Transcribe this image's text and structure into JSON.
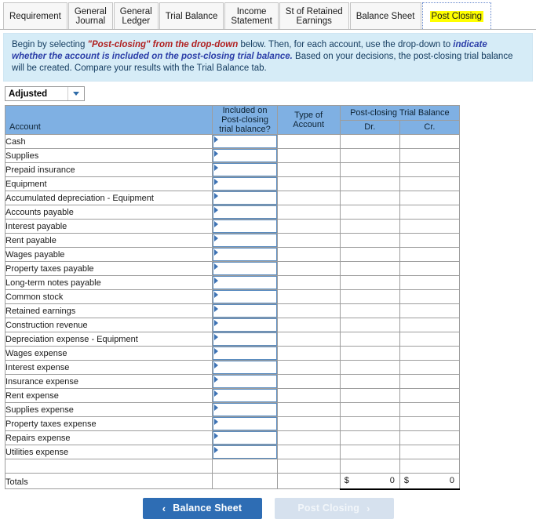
{
  "tabs": [
    {
      "label": "Requirement",
      "active": false
    },
    {
      "label": "General\nJournal",
      "active": false
    },
    {
      "label": "General\nLedger",
      "active": false
    },
    {
      "label": "Trial Balance",
      "active": false
    },
    {
      "label": "Income\nStatement",
      "active": false
    },
    {
      "label": "St of Retained\nEarnings",
      "active": false
    },
    {
      "label": "Balance Sheet",
      "active": false
    },
    {
      "label": "Post Closing",
      "active": true
    }
  ],
  "instructions": {
    "part1": "Begin by selecting ",
    "emph_red": "\"Post-closing\" from the drop-down",
    "part2": " below.  Then, for each account, use the drop-down to ",
    "emph_blue": "indicate whether the account is included on the post-closing trial balance.",
    "part3": "  Based on your decisions, the post-closing trial balance will be created.  Compare your results with the Trial Balance tab."
  },
  "period_select": {
    "value": "Adjusted",
    "icon": "chevron-down-icon"
  },
  "table": {
    "headers": {
      "account": "Account",
      "included": "Included on\nPost-closing\ntrial balance?",
      "type_of_account": "Type of\nAccount",
      "group": "Post-closing Trial Balance",
      "dr": "Dr.",
      "cr": "Cr."
    },
    "rows": [
      {
        "account": "Cash",
        "included": "",
        "type": "",
        "dr": "",
        "cr": ""
      },
      {
        "account": "Supplies",
        "included": "",
        "type": "",
        "dr": "",
        "cr": ""
      },
      {
        "account": "Prepaid insurance",
        "included": "",
        "type": "",
        "dr": "",
        "cr": ""
      },
      {
        "account": "Equipment",
        "included": "",
        "type": "",
        "dr": "",
        "cr": ""
      },
      {
        "account": "Accumulated depreciation - Equipment",
        "included": "",
        "type": "",
        "dr": "",
        "cr": ""
      },
      {
        "account": "Accounts payable",
        "included": "",
        "type": "",
        "dr": "",
        "cr": ""
      },
      {
        "account": "Interest payable",
        "included": "",
        "type": "",
        "dr": "",
        "cr": ""
      },
      {
        "account": "Rent payable",
        "included": "",
        "type": "",
        "dr": "",
        "cr": ""
      },
      {
        "account": "Wages payable",
        "included": "",
        "type": "",
        "dr": "",
        "cr": ""
      },
      {
        "account": "Property taxes payable",
        "included": "",
        "type": "",
        "dr": "",
        "cr": ""
      },
      {
        "account": "Long-term notes payable",
        "included": "",
        "type": "",
        "dr": "",
        "cr": ""
      },
      {
        "account": "Common stock",
        "included": "",
        "type": "",
        "dr": "",
        "cr": ""
      },
      {
        "account": "Retained earnings",
        "included": "",
        "type": "",
        "dr": "",
        "cr": ""
      },
      {
        "account": "Construction revenue",
        "included": "",
        "type": "",
        "dr": "",
        "cr": ""
      },
      {
        "account": "Depreciation expense - Equipment",
        "included": "",
        "type": "",
        "dr": "",
        "cr": ""
      },
      {
        "account": "Wages expense",
        "included": "",
        "type": "",
        "dr": "",
        "cr": ""
      },
      {
        "account": "Interest expense",
        "included": "",
        "type": "",
        "dr": "",
        "cr": ""
      },
      {
        "account": "Insurance expense",
        "included": "",
        "type": "",
        "dr": "",
        "cr": ""
      },
      {
        "account": "Rent expense",
        "included": "",
        "type": "",
        "dr": "",
        "cr": ""
      },
      {
        "account": "Supplies expense",
        "included": "",
        "type": "",
        "dr": "",
        "cr": ""
      },
      {
        "account": "Property taxes expense",
        "included": "",
        "type": "",
        "dr": "",
        "cr": ""
      },
      {
        "account": "Repairs expense",
        "included": "",
        "type": "",
        "dr": "",
        "cr": ""
      },
      {
        "account": "Utilities expense",
        "included": "",
        "type": "",
        "dr": "",
        "cr": ""
      }
    ],
    "spacer_row": true,
    "totals": {
      "label": "Totals",
      "dr_symbol": "$",
      "dr_value": "0",
      "cr_symbol": "$",
      "cr_value": "0"
    }
  },
  "footer": {
    "prev_button": {
      "label": "Balance Sheet",
      "icon": "chevron-left-icon",
      "enabled": true
    },
    "next_button": {
      "label": "Post Closing",
      "icon": "chevron-right-icon",
      "enabled": false
    }
  },
  "colors": {
    "header_blue": "#7fb0e3",
    "banner_blue": "#d6ecf7",
    "primary_button": "#2e6db4",
    "disabled_button": "#d6e1ee",
    "highlight_yellow": "#ffff00",
    "emph_red": "#b02020",
    "emph_blue": "#2b3ea8"
  }
}
